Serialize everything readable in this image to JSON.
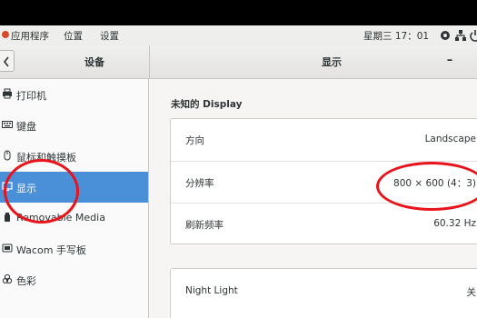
{
  "topbar": {
    "applications": "应用程序",
    "places": "位置",
    "settings": "设置",
    "clock": "星期三 17：01",
    "icons": [
      "accessibility-icon",
      "network-icon",
      "power-icon"
    ]
  },
  "header": {
    "sidebar_title": "设备",
    "page_title": "显示",
    "minimize": "–"
  },
  "sidebar": {
    "items": [
      {
        "label": "打印机",
        "icon": "printer-icon"
      },
      {
        "label": "键盘",
        "icon": "keyboard-icon"
      },
      {
        "label": "鼠标和触摸板",
        "icon": "mouse-icon"
      },
      {
        "label": "显示",
        "icon": "display-icon",
        "selected": true
      },
      {
        "label": "Removable Media",
        "icon": "removable-media-icon"
      },
      {
        "label": "Wacom 手写板",
        "icon": "tablet-icon"
      },
      {
        "label": "色彩",
        "icon": "color-icon"
      }
    ]
  },
  "main": {
    "display_name": "未知的 Display",
    "rows": [
      {
        "label": "方向",
        "value": "Landscape"
      },
      {
        "label": "分辨率",
        "value": "800 × 600 (4：3)"
      },
      {
        "label": "刷新频率",
        "value": "60.32 Hz"
      }
    ],
    "night_light": {
      "label": "Night Light",
      "value": "关"
    }
  },
  "colors": {
    "selection": "#4a90d9",
    "annotation": "#e8131b",
    "topbar": "#eeeeec"
  }
}
